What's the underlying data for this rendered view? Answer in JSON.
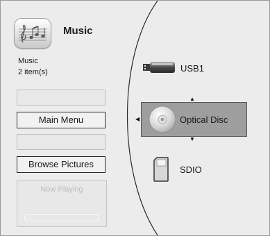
{
  "header": {
    "title": "Music",
    "icon": "music-note-icon"
  },
  "info": {
    "category": "Music",
    "item_count": "2 item(s)"
  },
  "menu": {
    "main_menu_label": "Main Menu",
    "browse_pictures_label": "Browse Pictures"
  },
  "now_playing": {
    "label": "Now Playing",
    "progress": 0
  },
  "devices": [
    {
      "label": "USB1",
      "icon": "usb-drive-icon",
      "selected": false
    },
    {
      "label": "Optical Disc",
      "icon": "optical-disc-icon",
      "selected": true
    },
    {
      "label": "SDIO",
      "icon": "sd-card-icon",
      "selected": false
    }
  ],
  "colors": {
    "background": "#ececec",
    "selected_item": "#9e9e9e",
    "accent": "#2a2a2a"
  }
}
